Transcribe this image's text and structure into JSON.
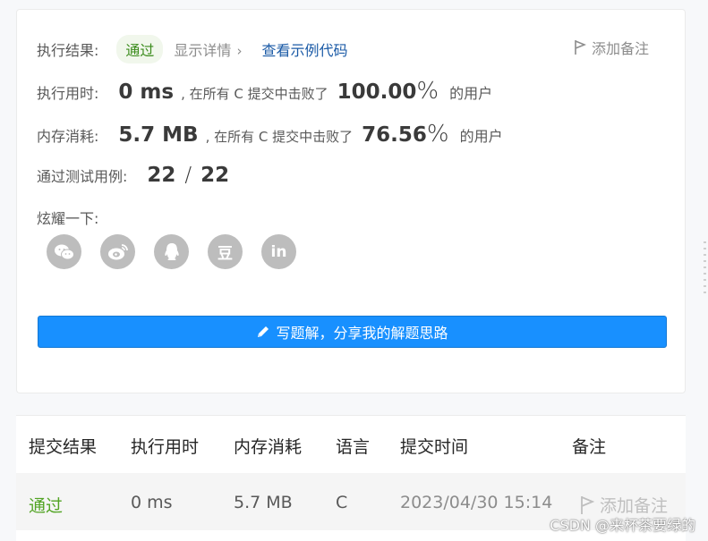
{
  "result": {
    "label": "执行结果:",
    "status": "通过",
    "detail_link": "显示详情",
    "detail_chevron": "›",
    "example_link": "查看示例代码",
    "add_note": "添加备注"
  },
  "runtime": {
    "label": "执行用时:",
    "value": "0 ms",
    "beat_text": ", 在所有 C 提交中击败了",
    "beat_pct": "100.00",
    "pct_sign": "%",
    "users": "的用户"
  },
  "memory": {
    "label": "内存消耗:",
    "value": "5.7 MB",
    "beat_text": ", 在所有 C 提交中击败了",
    "beat_pct": "76.56",
    "pct_sign": "%",
    "users": "的用户"
  },
  "tests": {
    "label": "通过测试用例:",
    "passed": "22",
    "sep": "/",
    "total": "22"
  },
  "share": {
    "label": "炫耀一下:",
    "icons": [
      "wechat-icon",
      "weibo-icon",
      "qq-icon",
      "douban-icon",
      "linkedin-icon"
    ],
    "douban_glyph": "豆",
    "linkedin_glyph": "in"
  },
  "write_button": "写题解，分享我的解题思路",
  "table": {
    "headers": [
      "提交结果",
      "执行用时",
      "内存消耗",
      "语言",
      "提交时间",
      "备注"
    ],
    "rows": [
      [
        "通过",
        "0 ms",
        "5.7 MB",
        "C",
        "2023/04/30 15:14",
        "添加备注"
      ]
    ]
  },
  "watermark": "CSDN @来杯茶要绿的",
  "colors": {
    "accent": "#1890ff",
    "pass": "#52a424",
    "link": "#1a5aa6"
  }
}
